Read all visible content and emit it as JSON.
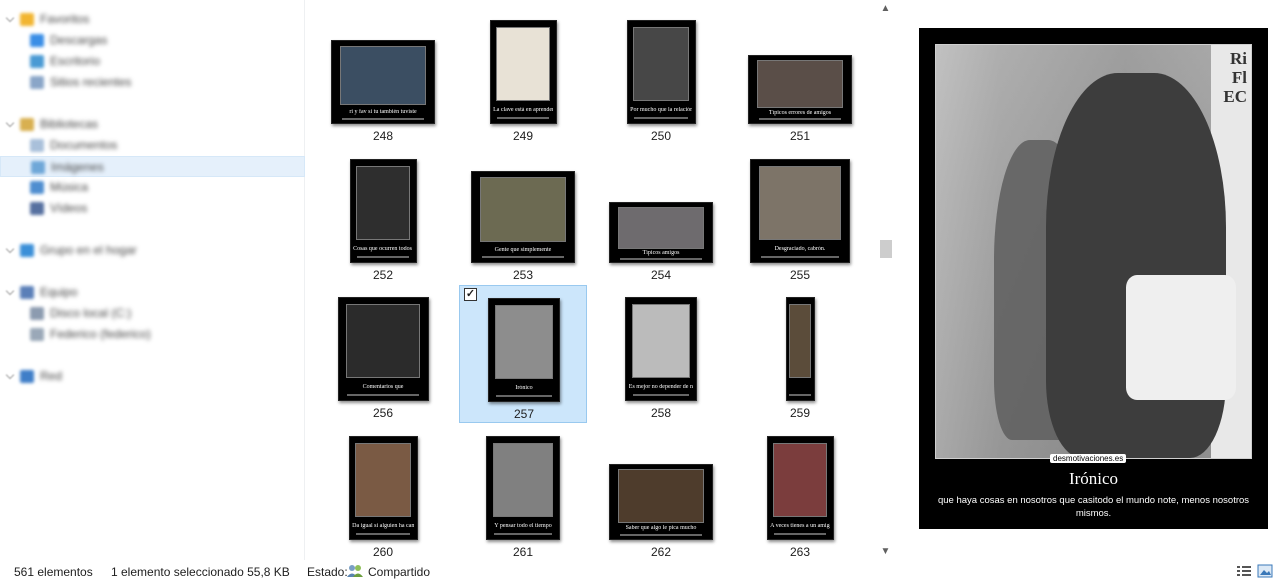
{
  "nav": {
    "items": [
      {
        "label": "Favoritos",
        "indent": 0,
        "color": "#f2b531",
        "chev": true
      },
      {
        "label": "Descargas",
        "indent": 1,
        "color": "#3a8ee6"
      },
      {
        "label": "Escritorio",
        "indent": 1,
        "color": "#4a9ad4"
      },
      {
        "label": "Sitios recientes",
        "indent": 1,
        "color": "#8aa6c8"
      },
      {
        "label": "",
        "spacer": true
      },
      {
        "label": "Bibliotecas",
        "indent": 0,
        "color": "#d8b050",
        "chev": true
      },
      {
        "label": "Documentos",
        "indent": 1,
        "color": "#a9c0da"
      },
      {
        "label": "Imágenes",
        "indent": 1,
        "color": "#6fa7d8",
        "selected": true
      },
      {
        "label": "Música",
        "indent": 1,
        "color": "#4f8ed0"
      },
      {
        "label": "Vídeos",
        "indent": 1,
        "color": "#5670a0"
      },
      {
        "label": "",
        "spacer": true
      },
      {
        "label": "Grupo en el hogar",
        "indent": 0,
        "color": "#3b8fd8",
        "chev": true
      },
      {
        "label": "",
        "spacer": true
      },
      {
        "label": "Equipo",
        "indent": 0,
        "color": "#5a7fb8",
        "chev": true
      },
      {
        "label": "Disco local (C:)",
        "indent": 1,
        "color": "#8c9bb0"
      },
      {
        "label": "Federico (federico)",
        "indent": 1,
        "color": "#9aa8b8"
      },
      {
        "label": "",
        "spacer": true
      },
      {
        "label": "Red",
        "indent": 0,
        "color": "#3f7ec8",
        "chev": true
      }
    ]
  },
  "files": [
    {
      "label": "248",
      "caption": "ri y fav si tu también tuviste",
      "w": 104,
      "h": 84,
      "color": "#3b4e62"
    },
    {
      "label": "249",
      "caption": "La clave está en aprender",
      "w": 67,
      "h": 104,
      "color": "#e8e2d6"
    },
    {
      "label": "250",
      "caption": "Por mucho que la relación",
      "w": 69,
      "h": 104,
      "color": "#474747"
    },
    {
      "label": "251",
      "caption": "Típicos errores de amigos",
      "w": 104,
      "h": 69,
      "color": "#5a4e48"
    },
    {
      "label": "252",
      "caption": "Cosas que ocurren todos los lunes",
      "w": 67,
      "h": 104,
      "color": "#2e2e2e"
    },
    {
      "label": "253",
      "caption": "Gente que simplemente",
      "w": 104,
      "h": 92,
      "color": "#6c6a52"
    },
    {
      "label": "254",
      "caption": "Típicos amigos",
      "w": 104,
      "h": 61,
      "color": "#6e6b6e"
    },
    {
      "label": "255",
      "caption": "Desgraciado, cabrón.",
      "w": 100,
      "h": 104,
      "color": "#7d7468"
    },
    {
      "label": "256",
      "caption": "Comentarios que",
      "w": 91,
      "h": 104,
      "color": "#2b2b2b"
    },
    {
      "label": "257",
      "caption": "Irónico",
      "w": 72,
      "h": 104,
      "color": "#8d8d8d",
      "selected": true
    },
    {
      "label": "258",
      "caption": "Es mejor no depender de nadie",
      "w": 72,
      "h": 104,
      "color": "#bbbbbb"
    },
    {
      "label": "259",
      "caption": "",
      "w": 29,
      "h": 104,
      "color": "#5b4c3a"
    },
    {
      "label": "260",
      "caption": "Da igual si alguien ha cambiado",
      "w": 69,
      "h": 104,
      "color": "#7a5a44"
    },
    {
      "label": "261",
      "caption": "Y pensar todo el tiempo",
      "w": 74,
      "h": 104,
      "color": "#808080"
    },
    {
      "label": "262",
      "caption": "Saber que algo le pica mucho",
      "w": 104,
      "h": 76,
      "color": "#4e3c2c"
    },
    {
      "label": "263",
      "caption": "A veces tienes a un amigo",
      "w": 67,
      "h": 104,
      "color": "#7b3d3d"
    }
  ],
  "preview": {
    "door_text": "Ri Fl EC",
    "watermark": "desmotivaciones.es",
    "title": "Irónico",
    "text": "que haya cosas en nosotros que casitodo el mundo note, menos nosotros mismos."
  },
  "status": {
    "count": "561 elementos",
    "selection": "1 elemento seleccionado  55,8 KB",
    "state_label": "Estado:",
    "state_value": "Compartido"
  }
}
